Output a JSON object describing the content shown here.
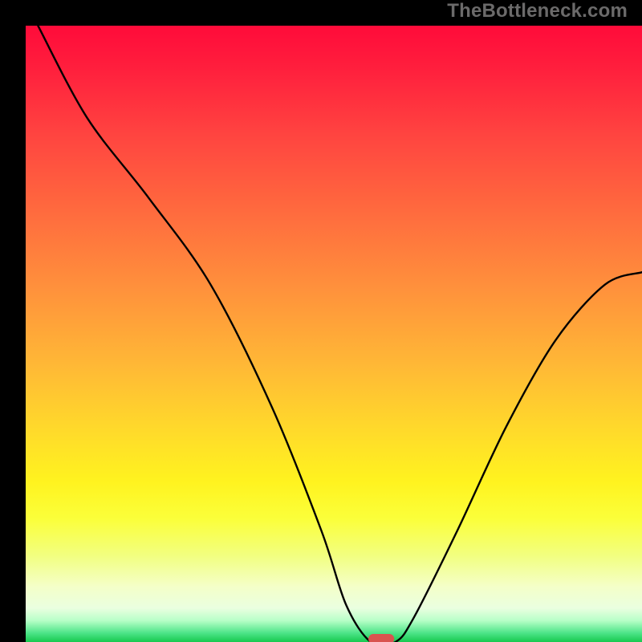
{
  "watermark": "TheBottleneck.com",
  "chart_data": {
    "type": "line",
    "title": "",
    "xlabel": "",
    "ylabel": "",
    "xlim": [
      0,
      100
    ],
    "ylim": [
      0,
      100
    ],
    "series": [
      {
        "name": "bottleneck-curve",
        "x": [
          2,
          10,
          20,
          30,
          40,
          48,
          52,
          56,
          60,
          63,
          70,
          78,
          86,
          94,
          100
        ],
        "y": [
          100,
          85,
          72,
          58,
          38,
          18,
          6,
          0,
          0,
          4,
          18,
          35,
          49,
          58,
          60
        ]
      }
    ],
    "marker": {
      "x": 57.7,
      "y": 0.5,
      "width": 4.2,
      "height": 1.6,
      "color": "#d9534f"
    },
    "gradient_stops": [
      {
        "offset": 0.0,
        "color": "#ff0b3a"
      },
      {
        "offset": 0.07,
        "color": "#ff1f3d"
      },
      {
        "offset": 0.18,
        "color": "#ff4540"
      },
      {
        "offset": 0.3,
        "color": "#ff6a3e"
      },
      {
        "offset": 0.42,
        "color": "#ff8f3c"
      },
      {
        "offset": 0.55,
        "color": "#ffb836"
      },
      {
        "offset": 0.66,
        "color": "#ffdb2a"
      },
      {
        "offset": 0.74,
        "color": "#fff31f"
      },
      {
        "offset": 0.8,
        "color": "#fbff3a"
      },
      {
        "offset": 0.86,
        "color": "#f2ff80"
      },
      {
        "offset": 0.91,
        "color": "#f4ffc8"
      },
      {
        "offset": 0.945,
        "color": "#eaffe0"
      },
      {
        "offset": 0.965,
        "color": "#b8ffc8"
      },
      {
        "offset": 0.985,
        "color": "#4fe58a"
      },
      {
        "offset": 1.0,
        "color": "#17c94f"
      }
    ]
  }
}
